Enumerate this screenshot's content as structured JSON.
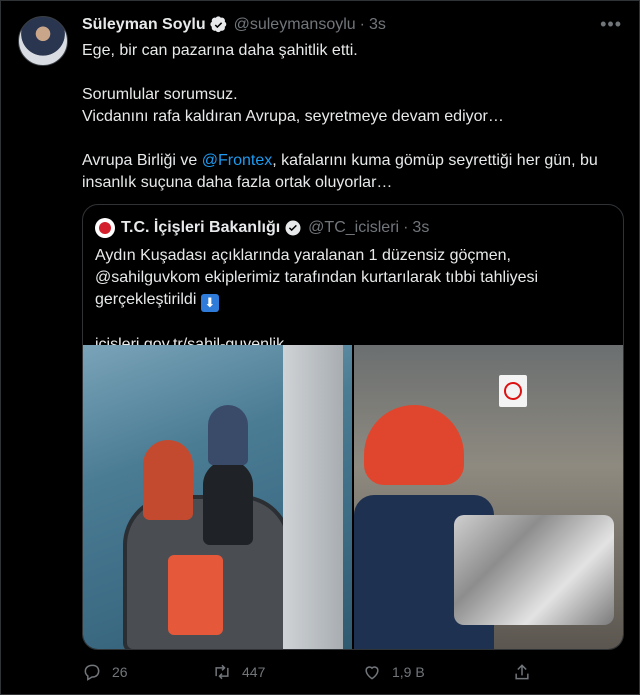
{
  "tweet": {
    "author_name": "Süleyman Soylu",
    "author_handle": "@suleymansoylu",
    "time": "3s",
    "line1": "Ege, bir can pazarına daha şahitlik etti.",
    "line2": "Sorumlular sorumsuz.",
    "line3": "Vicdanını rafa kaldıran Avrupa, seyretmeye devam ediyor…",
    "line4_pre": "Avrupa Birliği ve ",
    "line4_mention": "@Frontex",
    "line4_post": ", kafalarını kuma gömüp seyrettiği her gün, bu insanlık suçuna daha fazla ortak oluyorlar…"
  },
  "quote": {
    "author_name": "T.C. İçişleri Bakanlığı",
    "author_handle": "@TC_icisleri",
    "time": "3s",
    "text": "Aydın Kuşadası açıklarında yaralanan 1 düzensiz göçmen, @sahilguvkom ekiplerimiz tarafından kurtarılarak tıbbi tahliyesi gerçekleştirildi",
    "arrow": "⬇",
    "link": "icisleri.gov.tr/sahil-guvenlik…"
  },
  "actions": {
    "replies": "26",
    "retweets": "447",
    "likes": "1,9 B"
  },
  "colors": {
    "background": "#000000",
    "text": "#e7e9ea",
    "muted": "#71767b",
    "link": "#1d9bf0"
  }
}
